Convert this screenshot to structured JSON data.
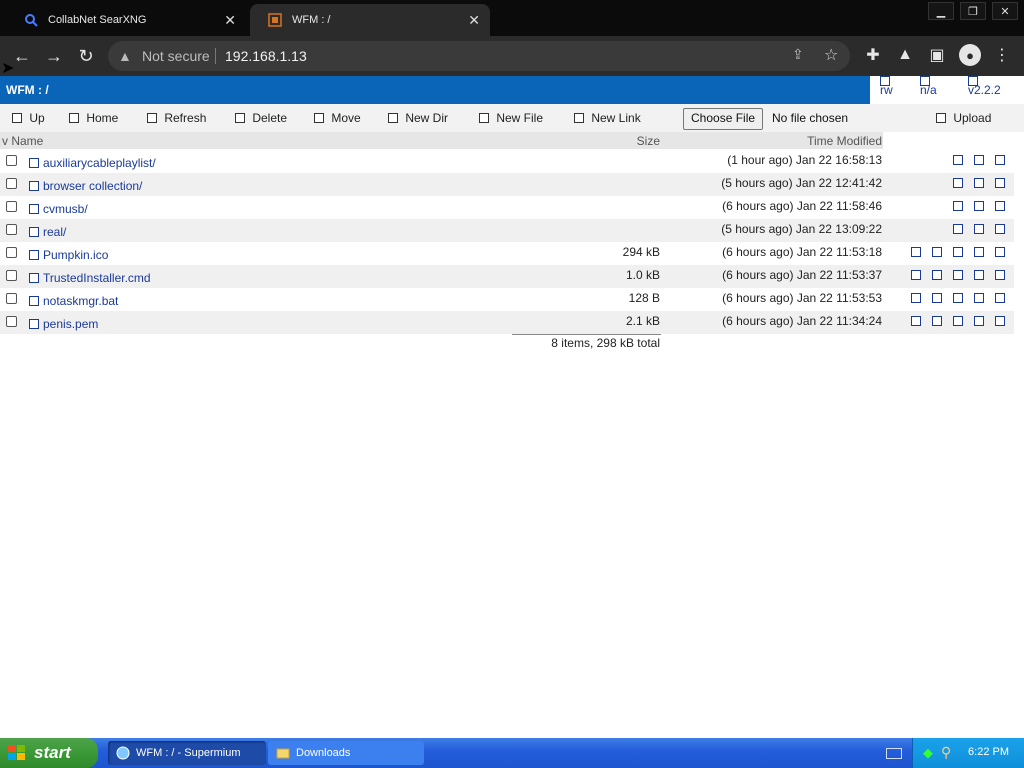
{
  "browser": {
    "tabs": [
      {
        "title": "CollabNet SearXNG",
        "icon": "search-icon",
        "active": false
      },
      {
        "title": "WFM : /",
        "icon": "wfm-favicon",
        "active": true
      }
    ],
    "address": {
      "security_label": "Not secure",
      "url": "192.168.1.13"
    }
  },
  "wfm": {
    "title": "WFM : /",
    "header_links": [
      {
        "label": "rw"
      },
      {
        "label": "n/a"
      },
      {
        "label": "v2.2.2"
      }
    ],
    "actions": [
      "Up",
      "Home",
      "Refresh",
      "Delete",
      "Move",
      "New Dir",
      "New File",
      "New Link"
    ],
    "file_input": {
      "button": "Choose File",
      "status": "No file chosen"
    },
    "upload_label": "Upload",
    "columns": {
      "name": "v Name",
      "size": "Size",
      "time": "Time Modified"
    },
    "files": [
      {
        "name": "auxiliarycableplaylist/",
        "size": "",
        "time": "(1 hour ago) Jan 22 16:58:13",
        "action_count": 3
      },
      {
        "name": "browser collection/",
        "size": "",
        "time": "(5 hours ago) Jan 22 12:41:42",
        "action_count": 3
      },
      {
        "name": "cvmusb/",
        "size": "",
        "time": "(6 hours ago) Jan 22 11:58:46",
        "action_count": 3
      },
      {
        "name": "real/",
        "size": "",
        "time": "(5 hours ago) Jan 22 13:09:22",
        "action_count": 3
      },
      {
        "name": "Pumpkin.ico",
        "size": "294 kB",
        "time": "(6 hours ago) Jan 22 11:53:18",
        "action_count": 5
      },
      {
        "name": "TrustedInstaller.cmd",
        "size": "1.0 kB",
        "time": "(6 hours ago) Jan 22 11:53:37",
        "action_count": 5
      },
      {
        "name": "notaskmgr.bat",
        "size": "128 B",
        "time": "(6 hours ago) Jan 22 11:53:53",
        "action_count": 5
      },
      {
        "name": "penis.pem",
        "size": "2.1 kB",
        "time": "(6 hours ago) Jan 22 11:34:24",
        "action_count": 5
      }
    ],
    "total": "8 items, 298 kB total"
  },
  "taskbar": {
    "start_label": "start",
    "tasks": [
      {
        "label": "WFM : / - Supermium",
        "icon": "browser-icon",
        "active": true
      },
      {
        "label": "Downloads",
        "icon": "folder-icon",
        "active": false
      }
    ],
    "clock": "6:22 PM"
  }
}
